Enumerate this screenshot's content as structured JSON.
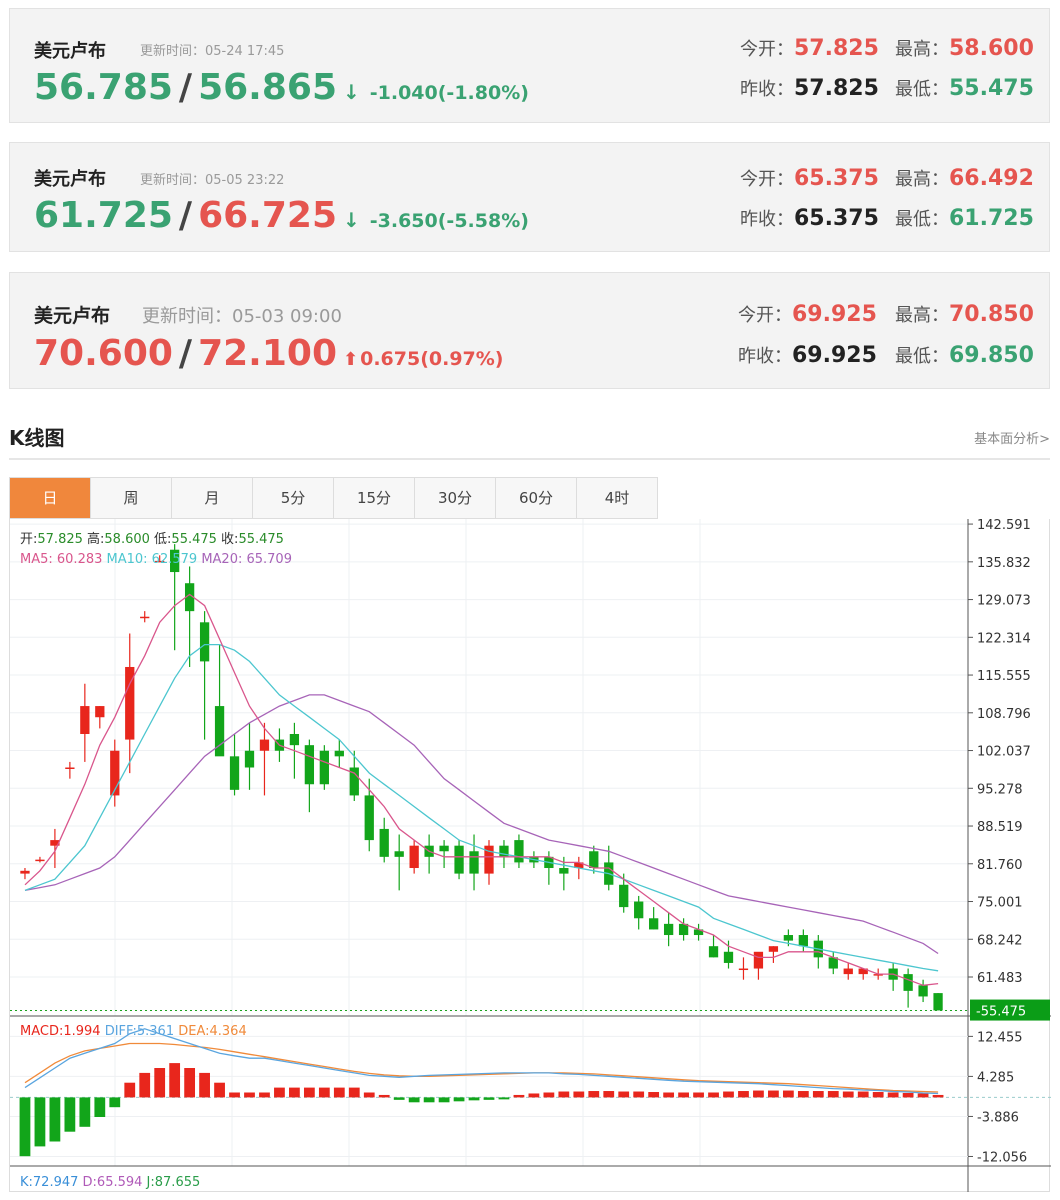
{
  "quotes": [
    {
      "name": "美元卢布",
      "time_label": "更新时间：",
      "time": "05-24 17:45",
      "bid": "56.785",
      "ask": "56.865",
      "change": "-1.040(-1.80%)",
      "direction": "down",
      "open_label": "今开：",
      "open": "57.825",
      "high_label": "最高：",
      "high": "58.600",
      "prev_label": "昨收：",
      "prev": "57.825",
      "low_label": "最低：",
      "low": "55.475"
    },
    {
      "name": "美元卢布",
      "time_label": "更新时间：",
      "time": "05-05 23:22",
      "bid": "61.725",
      "ask": "66.725",
      "change": "-3.650(-5.58%)",
      "direction": "down",
      "open_label": "今开：",
      "open": "65.375",
      "high_label": "最高：",
      "high": "66.492",
      "prev_label": "昨收：",
      "prev": "65.375",
      "low_label": "最低：",
      "low": "61.725"
    },
    {
      "name": "美元卢布",
      "time_label": "更新时间：",
      "time": "05-03 09:00",
      "bid": "70.600",
      "ask": "72.100",
      "change": "0.675(0.97%)",
      "direction": "up",
      "open_label": "今开：",
      "open": "69.925",
      "high_label": "最高：",
      "high": "70.850",
      "prev_label": "昨收：",
      "prev": "69.925",
      "low_label": "最低：",
      "low": "69.850"
    }
  ],
  "kline": {
    "title": "K线图",
    "analysis_link": "基本面分析>",
    "tabs": [
      "日",
      "周",
      "月",
      "5分",
      "15分",
      "30分",
      "60分",
      "4时"
    ],
    "active_tab": "日"
  },
  "colors": {
    "up": "#e8261c",
    "down": "#12a51a",
    "ma5": "#d9568c",
    "ma10": "#4cc6cf",
    "ma20": "#a764b8",
    "diff": "#5aa5df",
    "dea": "#f08a3a"
  },
  "chart_data": {
    "type": "candlestick",
    "info_line": {
      "open_label": "开:",
      "open": "57.825",
      "high_label": "高:",
      "high": "58.600",
      "low_label": "低:",
      "low": "55.475",
      "close_label": "收:",
      "close": "55.475"
    },
    "ma_legend": [
      {
        "label": "MA5:",
        "value": "60.283"
      },
      {
        "label": "MA10:",
        "value": "62.579"
      },
      {
        "label": "MA20:",
        "value": "65.709"
      }
    ],
    "y_ticks": [
      "142.591",
      "135.832",
      "129.073",
      "122.314",
      "115.555",
      "108.796",
      "102.037",
      "95.278",
      "88.519",
      "81.760",
      "75.001",
      "68.242",
      "61.483"
    ],
    "ylim": [
      54.5,
      143.5
    ],
    "last_price": "55.475",
    "candles": [
      [
        80,
        81,
        79,
        80.5
      ],
      [
        82.5,
        83,
        82,
        82.5
      ],
      [
        85,
        88,
        81,
        86
      ],
      [
        99,
        100,
        97,
        99
      ],
      [
        105,
        114,
        100,
        110
      ],
      [
        108,
        110,
        106,
        110
      ],
      [
        94,
        104,
        92,
        102
      ],
      [
        104,
        123,
        98,
        117
      ],
      [
        126,
        127,
        125,
        126
      ],
      [
        136,
        137,
        136,
        136
      ],
      [
        138,
        139,
        120,
        134
      ],
      [
        132,
        135,
        117,
        127
      ],
      [
        125,
        127,
        104,
        118
      ],
      [
        110,
        121,
        104,
        101
      ],
      [
        101,
        105,
        94,
        95
      ],
      [
        102,
        107,
        95,
        99
      ],
      [
        102,
        107,
        94,
        104
      ],
      [
        104,
        106,
        100,
        102
      ],
      [
        105,
        107,
        97,
        103
      ],
      [
        103,
        104,
        91,
        96
      ],
      [
        102,
        103,
        95,
        96
      ],
      [
        102,
        104,
        99,
        101
      ],
      [
        99,
        102,
        93,
        94
      ],
      [
        94,
        97,
        84,
        86
      ],
      [
        88,
        90,
        82,
        83
      ],
      [
        84,
        87,
        77,
        83
      ],
      [
        81,
        86,
        80,
        85
      ],
      [
        85,
        87,
        80,
        83
      ],
      [
        85,
        86,
        81,
        84
      ],
      [
        85,
        86,
        79,
        80
      ],
      [
        84,
        87,
        77,
        80
      ],
      [
        80,
        86,
        78,
        85
      ],
      [
        85,
        86,
        81,
        83
      ],
      [
        86,
        87,
        81,
        82
      ],
      [
        83,
        84,
        81,
        82
      ],
      [
        83,
        84,
        78,
        81
      ],
      [
        81,
        83,
        77,
        80
      ],
      [
        81,
        83,
        79,
        82
      ],
      [
        84,
        85,
        80,
        81
      ],
      [
        82,
        85,
        77,
        78
      ],
      [
        78,
        80,
        73,
        74
      ],
      [
        75,
        76,
        70,
        72
      ],
      [
        72,
        74,
        70,
        70
      ],
      [
        71,
        73,
        67,
        69
      ],
      [
        71,
        72,
        68,
        69
      ],
      [
        70,
        71,
        68,
        69
      ],
      [
        67,
        69,
        65,
        65
      ],
      [
        66,
        68,
        63,
        64
      ],
      [
        63,
        65,
        61,
        63
      ],
      [
        63,
        64,
        61,
        66
      ],
      [
        66,
        67,
        64,
        67
      ],
      [
        69,
        70,
        67,
        68
      ],
      [
        69,
        70,
        66,
        67
      ],
      [
        68,
        69,
        63,
        65
      ],
      [
        65,
        66,
        62,
        63
      ],
      [
        62,
        64,
        61,
        63
      ],
      [
        62,
        63,
        61,
        63
      ],
      [
        62,
        63,
        61,
        62
      ],
      [
        63,
        64,
        59,
        61
      ],
      [
        62,
        63,
        56,
        59
      ],
      [
        60,
        61,
        57,
        58
      ],
      [
        58.6,
        58.6,
        55.5,
        55.5
      ]
    ],
    "ma5": [
      78,
      80.5,
      84,
      90,
      96,
      103,
      108,
      114,
      119,
      125,
      128,
      130,
      128,
      122,
      116,
      110,
      106,
      103,
      102,
      101,
      100,
      99,
      98,
      95,
      92,
      88,
      86,
      84,
      83,
      83,
      83,
      83,
      83,
      83,
      83,
      83,
      82,
      82,
      81,
      81,
      79,
      77,
      75,
      73,
      71,
      70,
      69,
      67,
      66,
      65,
      65,
      66,
      66,
      66,
      65,
      64,
      63,
      62,
      62,
      61,
      60,
      60.3
    ],
    "ma10": [
      77,
      78,
      79,
      82,
      85,
      90,
      95,
      100,
      105,
      110,
      115,
      119,
      121,
      121,
      120,
      118,
      115,
      112,
      110,
      108,
      106,
      104,
      101,
      98,
      96,
      94,
      92,
      90,
      88,
      86,
      85,
      84,
      83.5,
      83,
      82.5,
      82,
      81.5,
      81,
      80.5,
      80,
      79,
      78,
      77,
      76,
      75,
      74,
      72,
      71,
      70,
      69,
      68,
      67.5,
      67,
      66.5,
      66,
      65.5,
      65,
      64.5,
      64,
      63.5,
      63,
      62.6
    ],
    "ma20": [
      77,
      77.5,
      78,
      79,
      80,
      81,
      83,
      86,
      89,
      92,
      95,
      98,
      101,
      103,
      105,
      107,
      108.5,
      110,
      111,
      112,
      112,
      111,
      110,
      109,
      107,
      105,
      103,
      100,
      97,
      95,
      93,
      91,
      89,
      88,
      87,
      86,
      85.5,
      85,
      84.5,
      84,
      83,
      82,
      81,
      80,
      79,
      78,
      77,
      76,
      75.5,
      75,
      74.5,
      74,
      73.5,
      73,
      72.5,
      72,
      71.5,
      70.5,
      69.5,
      68.5,
      67.5,
      65.7
    ],
    "macd_legend": [
      {
        "label": "MACD:",
        "value": "1.994"
      },
      {
        "label": "DIFF:",
        "value": "5.361"
      },
      {
        "label": "DEA:",
        "value": "4.364"
      }
    ],
    "macd_ticks": [
      "12.455",
      "4.285",
      "-3.886",
      "-12.056"
    ],
    "macd_ylim": [
      -14,
      16
    ],
    "macd_hist": [
      -12,
      -10,
      -9,
      -7,
      -6,
      -4,
      -2,
      3,
      5,
      6,
      7,
      6,
      5,
      3,
      1,
      1,
      1,
      2,
      2,
      2,
      2,
      2,
      2,
      1,
      0.5,
      -0.5,
      -1,
      -1,
      -1,
      -0.8,
      -0.6,
      -0.5,
      -0.4,
      0.5,
      0.8,
      1,
      1.2,
      1.2,
      1.3,
      1.3,
      1.2,
      1.2,
      1.1,
      1,
      1,
      1,
      1,
      1.2,
      1.3,
      1.4,
      1.4,
      1.4,
      1.3,
      1.3,
      1.3,
      1.2,
      1.2,
      1.1,
      1,
      0.9,
      0.8,
      0.5
    ],
    "diff": [
      2,
      4,
      6,
      8,
      9,
      10,
      11,
      13,
      14,
      13,
      12,
      11,
      10,
      9,
      8.5,
      8,
      8,
      7.5,
      7,
      6.5,
      6,
      5.5,
      5,
      4.5,
      4.3,
      4.1,
      4.3,
      4.5,
      4.6,
      4.7,
      4.8,
      4.9,
      5,
      5,
      5,
      5,
      4.8,
      4.7,
      4.5,
      4.3,
      4.1,
      3.9,
      3.7,
      3.5,
      3.3,
      3.2,
      3.1,
      3,
      2.9,
      2.8,
      2.6,
      2.4,
      2.2,
      2,
      1.8,
      1.7,
      1.5,
      1.4,
      1.2,
      1.1,
      0.9,
      0.8
    ],
    "dea": [
      3,
      5,
      7,
      8.5,
      9.5,
      10,
      10.5,
      11,
      11,
      11,
      10.8,
      10.5,
      10.2,
      9.8,
      9.3,
      8.8,
      8.3,
      7.8,
      7.3,
      6.8,
      6.3,
      5.8,
      5.3,
      4.9,
      4.6,
      4.4,
      4.3,
      4.3,
      4.4,
      4.5,
      4.6,
      4.7,
      4.8,
      4.9,
      5,
      5,
      5,
      4.9,
      4.8,
      4.6,
      4.4,
      4.2,
      4,
      3.8,
      3.6,
      3.4,
      3.3,
      3.2,
      3.1,
      3,
      2.9,
      2.8,
      2.6,
      2.4,
      2.2,
      2,
      1.8,
      1.6,
      1.4,
      1.3,
      1.2,
      1.1
    ],
    "kdj_legend": [
      {
        "label": "K:",
        "value": "72.947"
      },
      {
        "label": "D:",
        "value": "65.594"
      },
      {
        "label": "J:",
        "value": "87.655"
      }
    ]
  }
}
